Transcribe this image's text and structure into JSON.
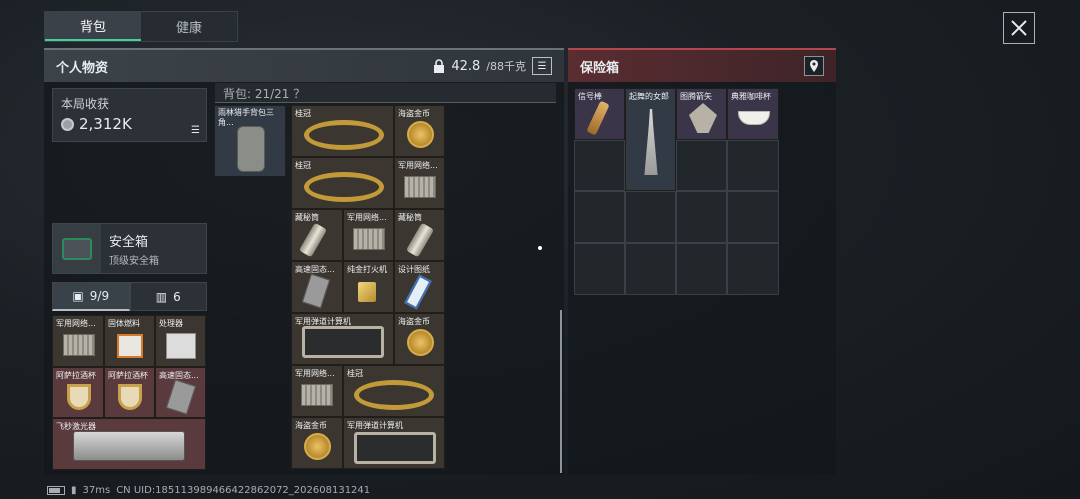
{
  "tabs": [
    {
      "label": "背包",
      "active": true
    },
    {
      "label": "健康",
      "active": false
    }
  ],
  "personal": {
    "title": "个人物资",
    "weight_value": "42.8",
    "weight_unit": "/88千克",
    "earnings_label": "本局收获",
    "earnings_value": "2,312K",
    "safebox_name": "安全箱",
    "safebox_desc": "顶级安全箱",
    "count_slots": "9/9",
    "count_items": "6",
    "bag_label": "背包: 21/21  ？"
  },
  "safe": {
    "title": "保险箱"
  },
  "safebox_items": [
    {
      "label": "军用网络..."
    },
    {
      "label": "固体燃料"
    },
    {
      "label": "处理器"
    },
    {
      "label": "阿萨拉酒杯"
    },
    {
      "label": "阿萨拉酒杯"
    },
    {
      "label": "高速固态..."
    },
    {
      "label": "飞秒激光器"
    }
  ],
  "backpack_item": {
    "label": "雨林猎手背包三角..."
  },
  "bag_items": [
    {
      "label": "桂冠"
    },
    {
      "label": "海盗金币"
    },
    {
      "label": "桂冠"
    },
    {
      "label": "军用网络..."
    },
    {
      "label": "藏秘筒"
    },
    {
      "label": "军用网络..."
    },
    {
      "label": "藏秘筒"
    },
    {
      "label": "高速固态..."
    },
    {
      "label": "纯金打火机"
    },
    {
      "label": "设计图纸"
    },
    {
      "label": "军用弹道计算机"
    },
    {
      "label": "海盗金币"
    },
    {
      "label": "军用网络..."
    },
    {
      "label": "桂冠"
    },
    {
      "label": "海盗金币"
    },
    {
      "label": "军用弹道计算机"
    }
  ],
  "safe_items": [
    {
      "label": "信号棒"
    },
    {
      "label": "起舞的女郎"
    },
    {
      "label": "图腾箭矢"
    },
    {
      "label": "典雅咖啡杯"
    }
  ],
  "status": {
    "ping": "37ms",
    "uid": "CN UID:18511398946642286207​2_202608131241"
  },
  "colors": {
    "accent_green": "#3fd29a",
    "safe_red": "#b3474d"
  }
}
